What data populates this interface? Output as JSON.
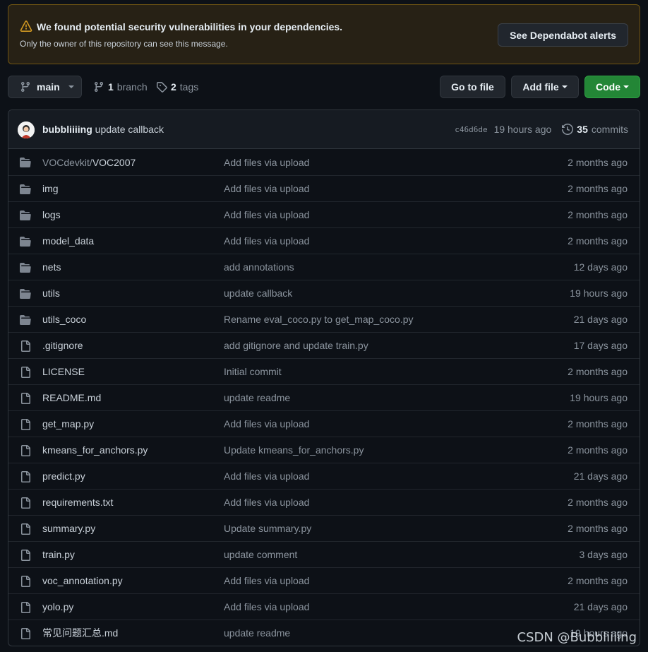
{
  "alert": {
    "title": "We found potential security vulnerabilities in your dependencies.",
    "message": "Only the owner of this repository can see this message.",
    "button": "See Dependabot alerts"
  },
  "toolbar": {
    "branch": "main",
    "branch_count": "1",
    "branch_label": "branch",
    "tag_count": "2",
    "tag_label": "tags",
    "go_to_file": "Go to file",
    "add_file": "Add file",
    "code": "Code"
  },
  "commit": {
    "author": "bubbliiiing",
    "message": "update callback",
    "sha": "c46d6de",
    "time": "19 hours ago",
    "count": "35",
    "count_label": "commits"
  },
  "files": [
    {
      "type": "dir",
      "prefix": "VOCdevkit/",
      "name": "VOC2007",
      "message": "Add files via upload",
      "age": "2 months ago"
    },
    {
      "type": "dir",
      "prefix": "",
      "name": "img",
      "message": "Add files via upload",
      "age": "2 months ago"
    },
    {
      "type": "dir",
      "prefix": "",
      "name": "logs",
      "message": "Add files via upload",
      "age": "2 months ago"
    },
    {
      "type": "dir",
      "prefix": "",
      "name": "model_data",
      "message": "Add files via upload",
      "age": "2 months ago"
    },
    {
      "type": "dir",
      "prefix": "",
      "name": "nets",
      "message": "add annotations",
      "age": "12 days ago"
    },
    {
      "type": "dir",
      "prefix": "",
      "name": "utils",
      "message": "update callback",
      "age": "19 hours ago"
    },
    {
      "type": "dir",
      "prefix": "",
      "name": "utils_coco",
      "message": "Rename eval_coco.py to get_map_coco.py",
      "age": "21 days ago"
    },
    {
      "type": "file",
      "prefix": "",
      "name": ".gitignore",
      "message": "add gitignore and update train.py",
      "age": "17 days ago"
    },
    {
      "type": "file",
      "prefix": "",
      "name": "LICENSE",
      "message": "Initial commit",
      "age": "2 months ago"
    },
    {
      "type": "file",
      "prefix": "",
      "name": "README.md",
      "message": "update readme",
      "age": "19 hours ago"
    },
    {
      "type": "file",
      "prefix": "",
      "name": "get_map.py",
      "message": "Add files via upload",
      "age": "2 months ago"
    },
    {
      "type": "file",
      "prefix": "",
      "name": "kmeans_for_anchors.py",
      "message": "Update kmeans_for_anchors.py",
      "age": "2 months ago"
    },
    {
      "type": "file",
      "prefix": "",
      "name": "predict.py",
      "message": "Add files via upload",
      "age": "21 days ago"
    },
    {
      "type": "file",
      "prefix": "",
      "name": "requirements.txt",
      "message": "Add files via upload",
      "age": "2 months ago"
    },
    {
      "type": "file",
      "prefix": "",
      "name": "summary.py",
      "message": "Update summary.py",
      "age": "2 months ago"
    },
    {
      "type": "file",
      "prefix": "",
      "name": "train.py",
      "message": "update comment",
      "age": "3 days ago"
    },
    {
      "type": "file",
      "prefix": "",
      "name": "voc_annotation.py",
      "message": "Add files via upload",
      "age": "2 months ago"
    },
    {
      "type": "file",
      "prefix": "",
      "name": "yolo.py",
      "message": "Add files via upload",
      "age": "21 days ago"
    },
    {
      "type": "file",
      "prefix": "",
      "name": "常见问题汇总.md",
      "message": "update readme",
      "age": "19 hours ago"
    }
  ],
  "watermark": "CSDN @Bubbliiiing",
  "colors": {
    "background": "#0d1117",
    "alert_bg": "#272115",
    "alert_border": "#6e5412",
    "warning_icon": "#d29922",
    "folder_icon": "#7d8590",
    "code_button": "#238636"
  }
}
